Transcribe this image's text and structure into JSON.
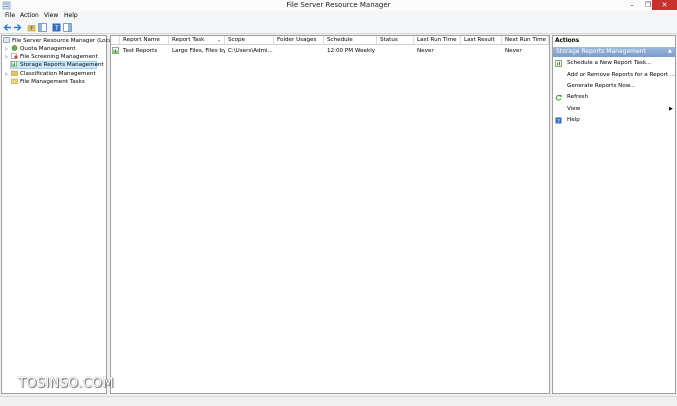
{
  "window": {
    "title": "File Server Resource Manager",
    "min": "–",
    "max": "❐",
    "close": "✕"
  },
  "menu": [
    "File",
    "Action",
    "View",
    "Help"
  ],
  "tree": {
    "root": "File Server Resource Manager (Local)",
    "items": [
      "Quota Management",
      "File Screening Management",
      "Storage Reports Management",
      "Classification Management",
      "File Management Tasks"
    ]
  },
  "table": {
    "headers": [
      "Report Name",
      "Report Task",
      "Scope",
      "Folder Usages",
      "Schedule",
      "Status",
      "Last Run Time",
      "Last Result",
      "Next Run Time"
    ],
    "rows": [
      [
        "Test Reports",
        "Large Files, Files by...",
        "C:\\Users\\Admi...",
        "",
        "12:00 PM Weekly ...",
        "",
        "Never",
        "",
        "Never"
      ]
    ]
  },
  "actions": {
    "title": "Actions",
    "section": "Storage Reports Management",
    "items": [
      "Schedule a New Report Task...",
      "Add or Remove Reports for a Report ...",
      "Generate Reports Now...",
      "Refresh",
      "View",
      "Help"
    ]
  },
  "watermark": {
    "brand": "TOSINSO.COM"
  },
  "colors": {
    "close": "#c7312e",
    "selection": "#cce8ff",
    "section_header": "#7a9cc7",
    "accent": "#1e6fb5"
  }
}
